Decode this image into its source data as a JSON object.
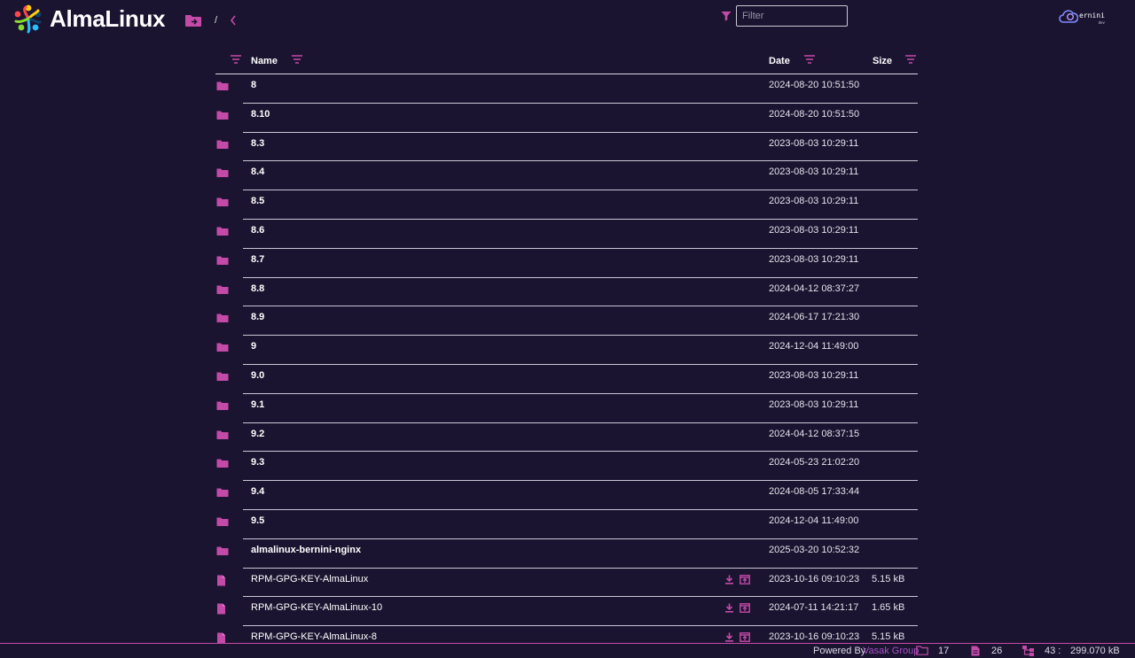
{
  "header": {
    "logo_text": "AlmaLinux",
    "path_separator": "/",
    "filter_placeholder": "Filter",
    "sponsor_text": "ernini",
    "sponsor_sub": "dev"
  },
  "table": {
    "columns": {
      "name": "Name",
      "date": "Date",
      "size": "Size"
    },
    "rows": [
      {
        "type": "dir",
        "name": "8",
        "date": "2024-08-20 10:51:50",
        "size": ""
      },
      {
        "type": "dir",
        "name": "8.10",
        "date": "2024-08-20 10:51:50",
        "size": ""
      },
      {
        "type": "dir",
        "name": "8.3",
        "date": "2023-08-03 10:29:11",
        "size": ""
      },
      {
        "type": "dir",
        "name": "8.4",
        "date": "2023-08-03 10:29:11",
        "size": ""
      },
      {
        "type": "dir",
        "name": "8.5",
        "date": "2023-08-03 10:29:11",
        "size": ""
      },
      {
        "type": "dir",
        "name": "8.6",
        "date": "2023-08-03 10:29:11",
        "size": ""
      },
      {
        "type": "dir",
        "name": "8.7",
        "date": "2023-08-03 10:29:11",
        "size": ""
      },
      {
        "type": "dir",
        "name": "8.8",
        "date": "2024-04-12 08:37:27",
        "size": ""
      },
      {
        "type": "dir",
        "name": "8.9",
        "date": "2024-06-17 17:21:30",
        "size": ""
      },
      {
        "type": "dir",
        "name": "9",
        "date": "2024-12-04 11:49:00",
        "size": ""
      },
      {
        "type": "dir",
        "name": "9.0",
        "date": "2023-08-03 10:29:11",
        "size": ""
      },
      {
        "type": "dir",
        "name": "9.1",
        "date": "2023-08-03 10:29:11",
        "size": ""
      },
      {
        "type": "dir",
        "name": "9.2",
        "date": "2024-04-12 08:37:15",
        "size": ""
      },
      {
        "type": "dir",
        "name": "9.3",
        "date": "2024-05-23 21:02:20",
        "size": ""
      },
      {
        "type": "dir",
        "name": "9.4",
        "date": "2024-08-05 17:33:44",
        "size": ""
      },
      {
        "type": "dir",
        "name": "9.5",
        "date": "2024-12-04 11:49:00",
        "size": ""
      },
      {
        "type": "dir",
        "name": "almalinux-bernini-nginx",
        "date": "2025-03-20 10:52:32",
        "size": ""
      },
      {
        "type": "file",
        "name": "RPM-GPG-KEY-AlmaLinux",
        "date": "2023-10-16 09:10:23",
        "size": "5.15 kB"
      },
      {
        "type": "file",
        "name": "RPM-GPG-KEY-AlmaLinux-10",
        "date": "2024-07-11 14:21:17",
        "size": "1.65 kB"
      },
      {
        "type": "file",
        "name": "RPM-GPG-KEY-AlmaLinux-8",
        "date": "2023-10-16 09:10:23",
        "size": "5.15 kB"
      }
    ]
  },
  "footer": {
    "powered_by": "Powered By",
    "powered_link": "Vasak Group",
    "folder_count": "17",
    "file_count": "26",
    "total_label": "43 :",
    "total_size": "299.070 kB"
  },
  "colors": {
    "background": "#1b1430",
    "accent": "#c44aa8",
    "link": "#a64fc4"
  },
  "icons": {
    "folder": "folder-icon",
    "file": "file-icon",
    "download": "download-icon",
    "open": "open-in-new-icon",
    "sort": "sort-icon",
    "filter": "filter-icon"
  }
}
